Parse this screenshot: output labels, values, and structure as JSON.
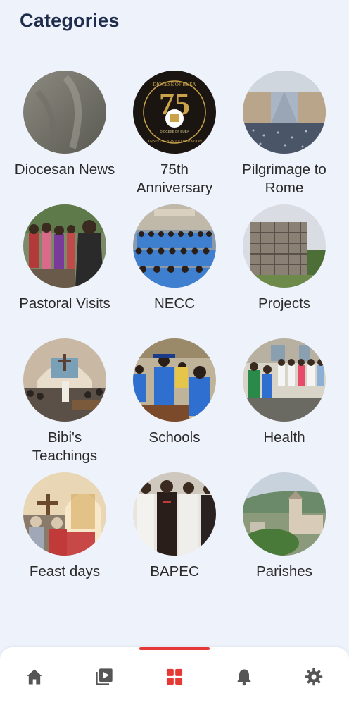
{
  "header": {
    "title": "Categories"
  },
  "categories": [
    {
      "label": "Diocesan News"
    },
    {
      "label": "75th\nAnniversary",
      "logo_number": "75",
      "logo_ring_text_top": "DIOCESE OF BUEA",
      "logo_ring_text_bottom": "ANNIVERSARY CELEBRATION",
      "logo_inner_text": "DIOCESE OF BUEA"
    },
    {
      "label": "Pilgrimage to\nRome"
    },
    {
      "label": "Pastoral Visits"
    },
    {
      "label": "NECC"
    },
    {
      "label": "Projects"
    },
    {
      "label": "Bibi's\nTeachings"
    },
    {
      "label": "Schools"
    },
    {
      "label": "Health"
    },
    {
      "label": "Feast days"
    },
    {
      "label": "BAPEC"
    },
    {
      "label": "Parishes"
    }
  ],
  "bottom_nav": {
    "items": [
      {
        "icon": "home-icon",
        "active": false
      },
      {
        "icon": "video-library-icon",
        "active": false
      },
      {
        "icon": "grid-icon",
        "active": true
      },
      {
        "icon": "bell-icon",
        "active": false
      },
      {
        "icon": "gear-icon",
        "active": false
      }
    ],
    "active_color": "#e53935",
    "inactive_color": "#555555"
  }
}
